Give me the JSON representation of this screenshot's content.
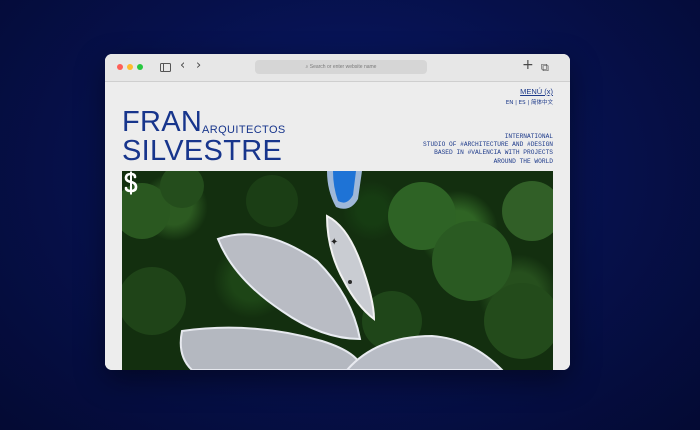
{
  "browser": {
    "address_placeholder": "Search or enter website name",
    "back_glyph": "‹",
    "forward_glyph": "›",
    "new_tab_glyph": "+",
    "tabs_glyph": "⧉"
  },
  "site": {
    "menu_label": "MENÚ (x)",
    "languages": "EN | ES | 简体中文",
    "brand_line1": "FRAN",
    "brand_sub": "ARQUITECTOS",
    "brand_line2": "SILVESTRE",
    "tagline": [
      "INTERNATIONAL",
      "STUDIO OF #ARCHITECTURE AND #DESIGN",
      "BASED IN #VALENCIA WITH PROJECTS",
      "AROUND THE WORLD"
    ],
    "hero_image": "aerial view of petal-shaped house among trees",
    "logo_mark": "s-dollar-logo"
  },
  "colors": {
    "brand_blue": "#17358c",
    "background": "#06104a"
  }
}
